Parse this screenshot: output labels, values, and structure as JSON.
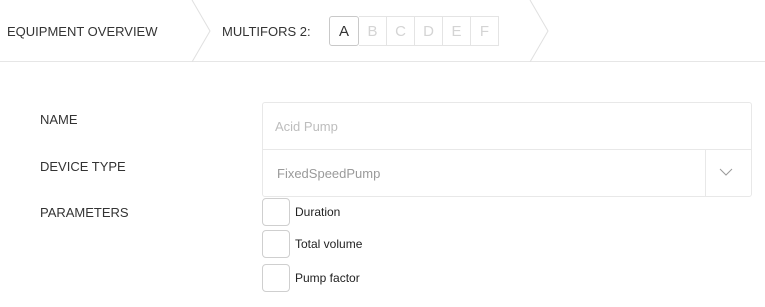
{
  "breadcrumb": {
    "overview": "EQUIPMENT OVERVIEW",
    "multifors": "MULTIFORS 2:",
    "letters": [
      "A",
      "B",
      "C",
      "D",
      "E",
      "F"
    ],
    "active_letter": "A"
  },
  "form": {
    "name_label": "NAME",
    "name_placeholder": "Acid Pump",
    "device_type_label": "DEVICE TYPE",
    "device_type_value": "FixedSpeedPump",
    "parameters_label": "PARAMETERS",
    "parameters": [
      "Duration",
      "Total volume",
      "Pump factor"
    ]
  },
  "icons": {
    "dropdown": "chevron-down-icon"
  },
  "colors": {
    "border": "#e8e8e8",
    "muted_text": "#bdbdbd",
    "text": "#333333"
  }
}
